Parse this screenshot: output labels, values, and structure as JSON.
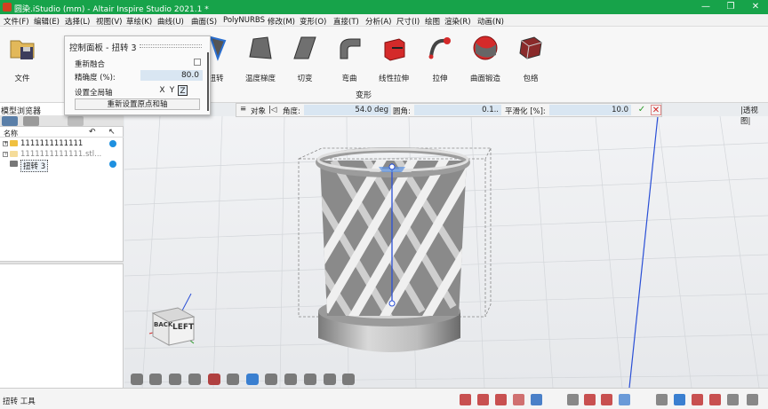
{
  "window": {
    "title": "圆染.iStudio (mm) - Altair Inspire Studio 2021.1 *",
    "minimize": "—",
    "restore": "❐",
    "close": "✕"
  },
  "menu": [
    "文件(F)",
    "编辑(E)",
    "选择(L)",
    "视图(V)",
    "草绘(K)",
    "曲线(U)",
    "曲面(S)",
    "PolyNURBS",
    "修改(M)",
    "变形(O)",
    "直接(T)",
    "分析(A)",
    "尺寸(I)",
    "绘图",
    "渲染(R)",
    "动画(N)"
  ],
  "ribbon": {
    "file_label": "文件",
    "tools": [
      "扭转",
      "温度梯度",
      "切变",
      "弯曲",
      "线性拉伸",
      "拉伸",
      "曲面锻造",
      "包络"
    ],
    "group_label": "变形"
  },
  "control_panel": {
    "title": "控制面板 - 扭转 3",
    "remerge_label": "重新融合",
    "precision_label": "精确度 (%):",
    "precision_value": "80.0",
    "global_axis_label": "设置全局轴",
    "axis_x": "X",
    "axis_y": "Y",
    "axis_z": "Z",
    "reset_button": "重新设置原点和轴"
  },
  "model_browser": {
    "title": "模型浏览器",
    "col_name": "名称",
    "items": [
      {
        "label": "1111111111111"
      },
      {
        "label": "1111111111111.stl..."
      },
      {
        "label": "扭转 3"
      }
    ]
  },
  "guide_bar": {
    "object_label": "对象",
    "angle_label": "角度:",
    "angle_value": "54.0 deg",
    "rounding_label": "圆角:",
    "rounding_value": "0.1..",
    "smooth_label": "平滑化 [%]:",
    "smooth_value": "10.0"
  },
  "viewport": {
    "projection_label": "|透视图|",
    "cube_front": "LEFT",
    "cube_side": "BACK"
  },
  "status": {
    "text": "扭转 工具"
  },
  "colors": {
    "titlebar": "#17a34a",
    "accent": "#2a6fd0",
    "axis_line": "#2a4fd6"
  }
}
